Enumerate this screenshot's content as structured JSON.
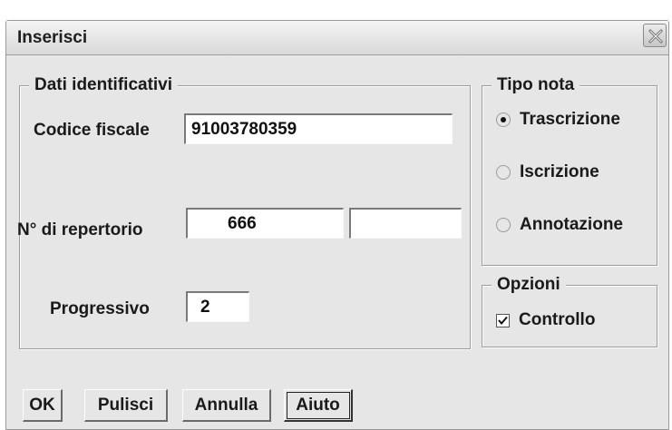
{
  "window": {
    "title": "Inserisci",
    "close_icon": "close-icon"
  },
  "dati": {
    "legend": "Dati identificativi",
    "codice_fiscale_label": "Codice fiscale",
    "codice_fiscale_value": "91003780359",
    "repertorio_label": "N° di repertorio",
    "repertorio_value1": "666",
    "repertorio_value2": "",
    "progressivo_label": "Progressivo",
    "progressivo_value": "2"
  },
  "tipo_nota": {
    "legend": "Tipo nota",
    "options": [
      {
        "label": "Trascrizione",
        "selected": true
      },
      {
        "label": "Iscrizione",
        "selected": false
      },
      {
        "label": "Annotazione",
        "selected": false
      }
    ]
  },
  "opzioni": {
    "legend": "Opzioni",
    "controllo_label": "Controllo",
    "controllo_checked": true
  },
  "buttons": {
    "ok": "OK",
    "pulisci": "Pulisci",
    "annulla": "Annulla",
    "aiuto": "Aiuto"
  }
}
